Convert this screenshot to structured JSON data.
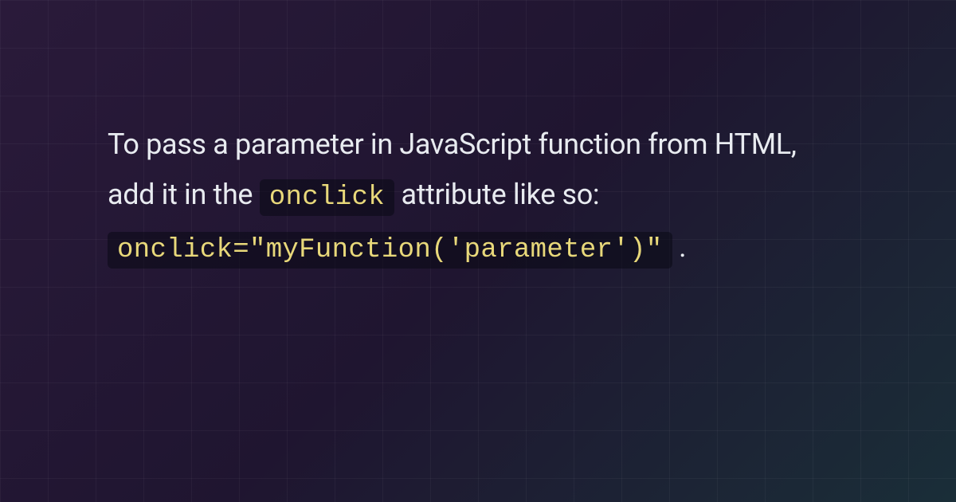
{
  "content": {
    "text_part_1": "To pass a parameter in JavaScript function from HTML, add it in the ",
    "code_inline_1": "onclick",
    "text_part_2": " attribute like so:",
    "code_inline_2": "onclick=\"myFunction('parameter')\"",
    "text_part_3": " ."
  },
  "colors": {
    "text": "#e8ebf0",
    "code_text": "#e8d87a",
    "code_bg": "rgba(10,10,20,0.55)"
  }
}
